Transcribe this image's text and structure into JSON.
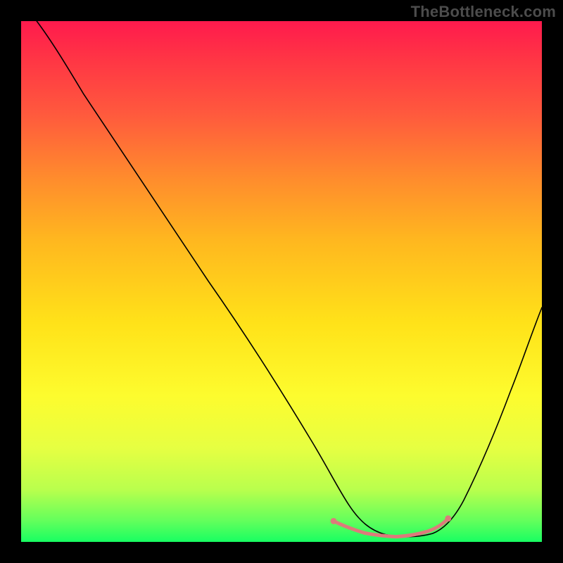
{
  "watermark": "TheBottleneck.com",
  "chart_data": {
    "type": "line",
    "title": "",
    "xlabel": "",
    "ylabel": "",
    "xlim": [
      0,
      100
    ],
    "ylim": [
      0,
      100
    ],
    "series": [
      {
        "name": "bottleneck-curve",
        "color": "#000000",
        "x": [
          3,
          6,
          10,
          15,
          20,
          25,
          30,
          35,
          40,
          45,
          50,
          55,
          58,
          60,
          62,
          65,
          68,
          72,
          76,
          80,
          84,
          88,
          92,
          96,
          100
        ],
        "y": [
          100,
          96,
          90,
          83,
          76,
          69,
          62,
          55,
          47,
          40,
          32,
          23,
          17,
          12,
          8,
          4,
          2,
          1,
          1,
          2,
          6,
          14,
          24,
          34,
          45
        ]
      },
      {
        "name": "optimal-range-marker",
        "color": "#e06666",
        "x": [
          60,
          62,
          64,
          66,
          68,
          70,
          72,
          74,
          76,
          78,
          80,
          82
        ],
        "y": [
          4.0,
          3.0,
          2.3,
          1.7,
          1.3,
          1.1,
          1.0,
          1.1,
          1.4,
          2.0,
          3.0,
          4.5
        ]
      }
    ],
    "gradient_stops": [
      {
        "pos": 0,
        "color": "#ff1a4d"
      },
      {
        "pos": 7,
        "color": "#ff3445"
      },
      {
        "pos": 18,
        "color": "#ff5a3d"
      },
      {
        "pos": 30,
        "color": "#ff8b2d"
      },
      {
        "pos": 42,
        "color": "#ffb71f"
      },
      {
        "pos": 58,
        "color": "#ffe219"
      },
      {
        "pos": 72,
        "color": "#fdfc2e"
      },
      {
        "pos": 82,
        "color": "#e6ff42"
      },
      {
        "pos": 90,
        "color": "#b9ff4d"
      },
      {
        "pos": 96,
        "color": "#62ff5c"
      },
      {
        "pos": 100,
        "color": "#18ff62"
      }
    ],
    "marker_dots": [
      {
        "x": 60,
        "y": 4.0
      },
      {
        "x": 82,
        "y": 4.5
      }
    ]
  }
}
